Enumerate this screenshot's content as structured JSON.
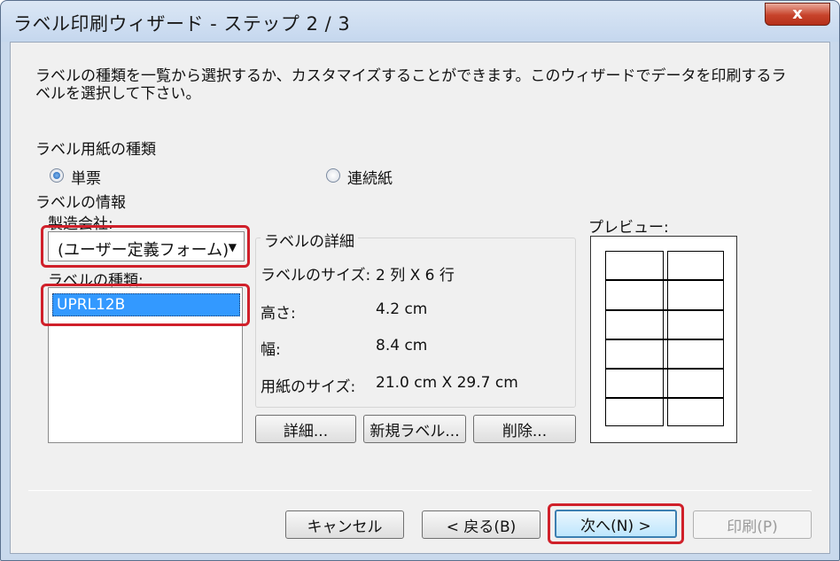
{
  "window": {
    "title": "ラベル印刷ウィザード - ステップ 2 / 3",
    "close_label": "x"
  },
  "description": "ラベルの種類を一覧から選択するか、カスタマイズすることができます。このウィザードでデータを印刷するラベルを選択して下さい。",
  "paper_type": {
    "label": "ラベル用紙の種類",
    "options": [
      {
        "label": "単票",
        "checked": true
      },
      {
        "label": "連続紙",
        "checked": false
      }
    ]
  },
  "label_info": {
    "label": "ラベルの情報",
    "manufacturer_label": "製造会社:",
    "manufacturer_value": "(ユーザー定義フォーム)",
    "type_label": "ラベルの種類:",
    "type_items": [
      "UPRL12B"
    ]
  },
  "details": {
    "label": "ラベルの詳細",
    "rows": [
      {
        "key": "ラベルのサイズ:",
        "value": "2 列 X 6 行"
      },
      {
        "key": "高さ:",
        "value": "4.2 cm"
      },
      {
        "key": "幅:",
        "value": "8.4 cm"
      },
      {
        "key": "用紙のサイズ:",
        "value": "21.0 cm X 29.7 cm"
      }
    ],
    "buttons": {
      "detail": "詳細...",
      "new_label": "新規ラベル...",
      "delete": "削除..."
    }
  },
  "preview": {
    "label": "プレビュー:",
    "columns": 2,
    "rows": 6
  },
  "footer": {
    "cancel": "キャンセル",
    "back": "< 戻る(B)",
    "next": "次へ(N) >",
    "print": "印刷(P)"
  },
  "colors": {
    "highlight_red": "#d0202a",
    "selection_blue": "#3399ff"
  }
}
